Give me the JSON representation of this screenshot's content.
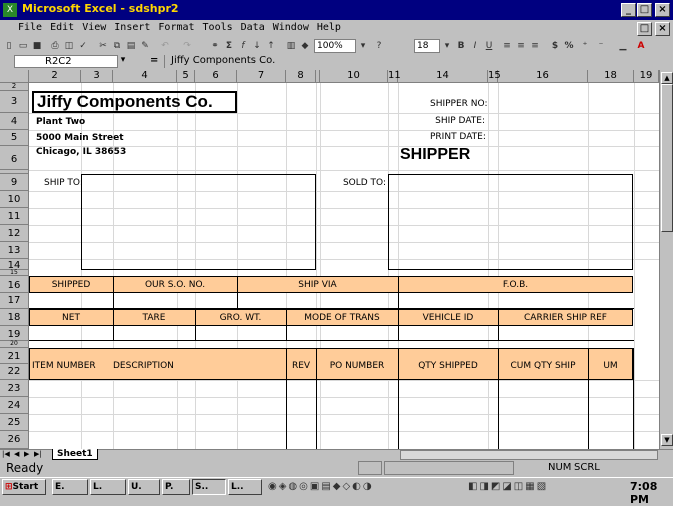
{
  "window": {
    "title": "Microsoft Excel - sdshpr2",
    "minimize": "_",
    "maximize": "□",
    "close": "×"
  },
  "menu": [
    "File",
    "Edit",
    "View",
    "Insert",
    "Format",
    "Tools",
    "Data",
    "Window",
    "Help"
  ],
  "toolbar": {
    "zoom": "100%",
    "font_size": "18",
    "bold": "B",
    "italic": "I",
    "underline": "U",
    "currency": "$",
    "percent": "%"
  },
  "formula_bar": {
    "name_box": "R2C2",
    "equals": "=",
    "content": "Jiffy Components Co."
  },
  "columns": [
    "2",
    "3",
    "4",
    "5",
    "6",
    "7",
    "8",
    "9",
    "10",
    "11",
    "14",
    "15",
    "16",
    "18",
    "19"
  ],
  "rows": [
    "2",
    "3",
    "4",
    "5",
    "6",
    "9",
    "10",
    "11",
    "12",
    "13",
    "14",
    "15",
    "16",
    "17",
    "18",
    "19",
    "20",
    "21",
    "22",
    "23",
    "24",
    "25",
    "26"
  ],
  "sheet": {
    "company": "Jiffy Components Co.",
    "plant": "Plant Two",
    "street": "5000 Main Street",
    "city": "Chicago, IL  38653",
    "shipper_no": "SHIPPER NO:",
    "ship_date": "SHIP DATE:",
    "print_date": "PRINT DATE:",
    "shipper_title": "SHIPPER",
    "ship_to": "SHIP TO:",
    "sold_to": "SOLD TO:",
    "hdr1": [
      "SHIPPED",
      "OUR S.O. NO.",
      "SHIP VIA",
      "F.O.B."
    ],
    "hdr2": [
      "NET",
      "TARE",
      "GRO. WT.",
      "MODE OF TRANS",
      "VEHICLE ID",
      "CARRIER SHIP REF"
    ],
    "hdr3": [
      "ITEM NUMBER",
      "DESCRIPTION",
      "REV",
      "PO NUMBER",
      "QTY SHIPPED",
      "CUM QTY SHIP",
      "UM"
    ]
  },
  "sheet_tab": "Sheet1",
  "status": {
    "mode": "Ready",
    "num": "NUM",
    "scrl": "SCRL"
  },
  "taskbar": {
    "start": "Start",
    "clock": "7:08 PM",
    "items": [
      "E.",
      "L.",
      "U.",
      "P.",
      "S..",
      "L.."
    ]
  }
}
